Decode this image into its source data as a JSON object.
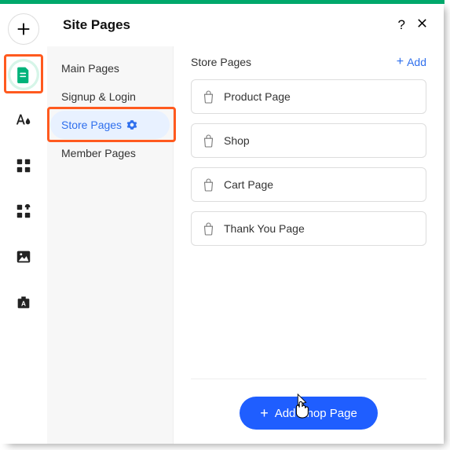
{
  "header": {
    "title": "Site Pages",
    "help": "?",
    "close": "✕"
  },
  "sidenav": {
    "items": [
      {
        "label": "Main Pages"
      },
      {
        "label": "Signup & Login"
      },
      {
        "label": "Store Pages"
      },
      {
        "label": "Member Pages"
      }
    ],
    "active_index": 2
  },
  "main": {
    "title": "Store Pages",
    "add_label": "Add",
    "pages": [
      {
        "label": "Product Page"
      },
      {
        "label": "Shop"
      },
      {
        "label": "Cart Page"
      },
      {
        "label": "Thank You Page"
      }
    ],
    "add_shop_label": "Add Shop Page"
  }
}
